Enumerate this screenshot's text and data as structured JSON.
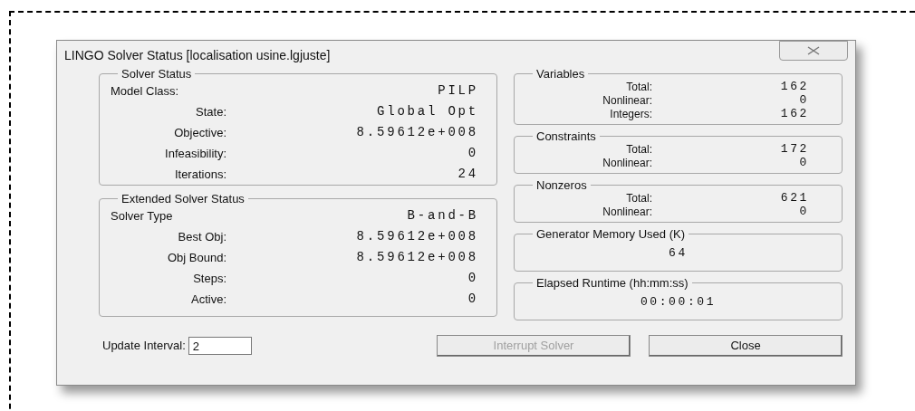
{
  "window": {
    "title": "LINGO Solver Status [localisation usine.lgjuste]"
  },
  "solver_status": {
    "title": "Solver Status",
    "rows": [
      {
        "kind": "left",
        "label": "Model Class:",
        "value": "PILP"
      },
      {
        "kind": "right",
        "label": "State:",
        "value": "Global Opt"
      },
      {
        "kind": "right",
        "label": "Objective:",
        "value": "8.59612e+008"
      },
      {
        "kind": "right",
        "label": "Infeasibility:",
        "value": "0"
      },
      {
        "kind": "right",
        "label": "Iterations:",
        "value": "24"
      }
    ]
  },
  "extended_solver_status": {
    "title": "Extended Solver Status",
    "rows": [
      {
        "kind": "left",
        "label": "Solver Type",
        "value": "B-and-B"
      },
      {
        "kind": "right",
        "label": "Best Obj:",
        "value": "8.59612e+008"
      },
      {
        "kind": "right",
        "label": "Obj Bound:",
        "value": "8.59612e+008"
      },
      {
        "kind": "right",
        "label": "Steps:",
        "value": "0"
      },
      {
        "kind": "right",
        "label": "Active:",
        "value": "0"
      }
    ]
  },
  "right_groups": [
    {
      "kind": "table",
      "title": "Variables",
      "rows": [
        {
          "label": "Total:",
          "value": "162"
        },
        {
          "label": "Nonlinear:",
          "value": "0"
        },
        {
          "label": "Integers:",
          "value": "162"
        }
      ]
    },
    {
      "kind": "table",
      "title": "Constraints",
      "rows": [
        {
          "label": "Total:",
          "value": "172"
        },
        {
          "label": "Nonlinear:",
          "value": "0"
        }
      ]
    },
    {
      "kind": "table",
      "title": "Nonzeros",
      "rows": [
        {
          "label": "Total:",
          "value": "621"
        },
        {
          "label": "Nonlinear:",
          "value": "0"
        }
      ]
    },
    {
      "kind": "single",
      "title": "Generator Memory Used (K)",
      "value": "64"
    },
    {
      "kind": "single",
      "title": "Elapsed Runtime (hh:mm:ss)",
      "value": "00:00:01"
    }
  ],
  "update_interval": {
    "label": "Update Interval:",
    "value": "2"
  },
  "buttons": [
    {
      "label": "Interrupt Solver",
      "disabled": true
    },
    {
      "label": "Close",
      "disabled": false
    }
  ]
}
